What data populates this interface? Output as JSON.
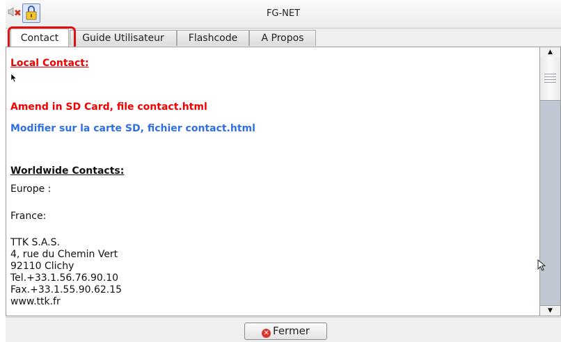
{
  "window": {
    "title": "FG-NET"
  },
  "titlebar_icons": [
    "speaker-icon",
    "close-x-icon",
    "lock-icon"
  ],
  "tabs": [
    {
      "label": "Contact",
      "active": true
    },
    {
      "label": "Guide Utilisateur",
      "active": false
    },
    {
      "label": "Flashcode",
      "active": false
    },
    {
      "label": "A Propos",
      "active": false
    }
  ],
  "content": {
    "local_contact_heading": "Local Contact:",
    "amend_line": "Amend in SD Card, file contact.html",
    "modifier_line": "Modifier sur la carte SD, fichier contact.html",
    "worldwide_heading": "Worldwide Contacts:",
    "europe_label": "Europe :",
    "france_label": "France:",
    "address": [
      "TTK S.A.S.",
      "4, rue du Chemin Vert",
      "92110 Clichy",
      "Tel.+33.1.56.76.90.10",
      "Fax.+33.1.55.90.62.15",
      "www.ttk.fr"
    ]
  },
  "footer": {
    "close_label": "Fermer"
  },
  "colors": {
    "heading_red": "#f00000",
    "text_blue": "#2f6fe6",
    "highlight_red": "#e01010"
  }
}
